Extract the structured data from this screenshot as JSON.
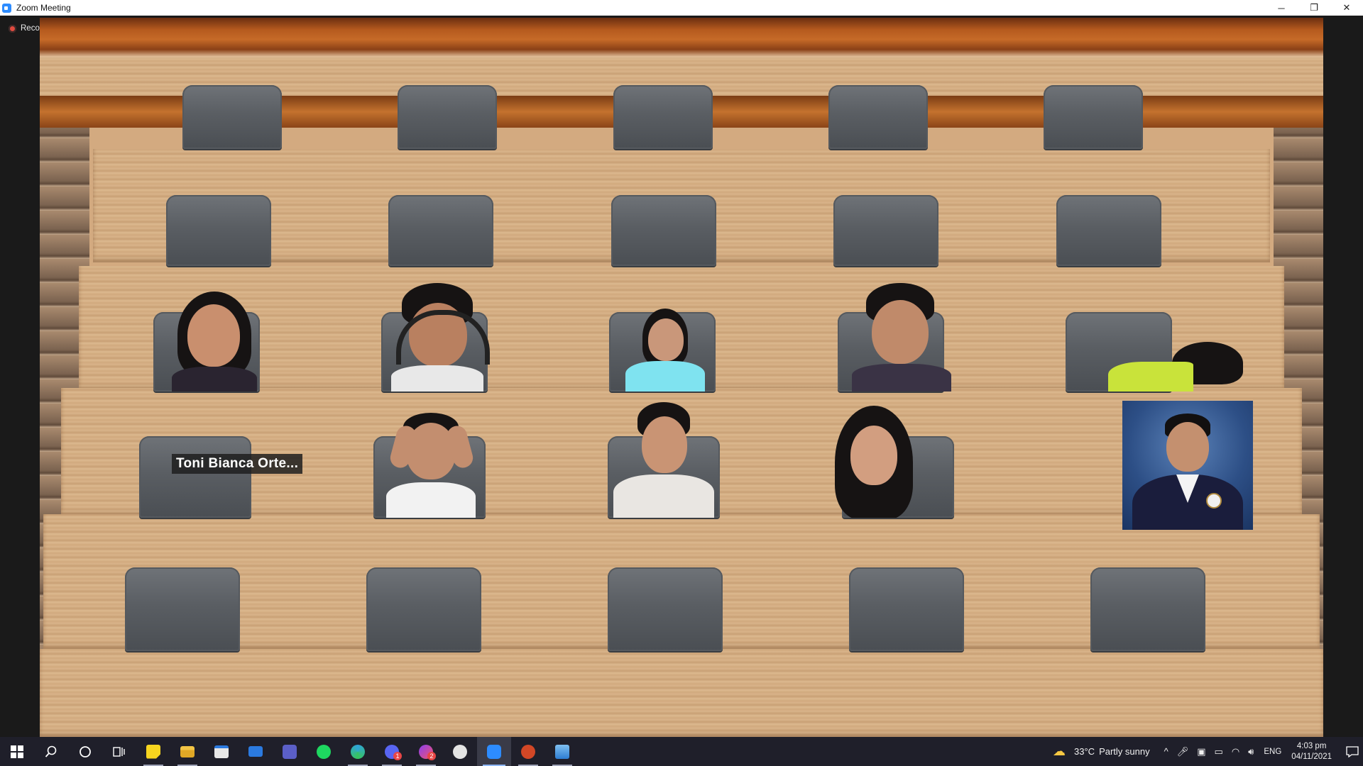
{
  "window": {
    "title": "Zoom Meeting",
    "minimize_glyph": "─",
    "restore_glyph": "❐",
    "close_glyph": "✕"
  },
  "meeting": {
    "recording_label": "Recording",
    "name_label": "Toni Bianca Orte..."
  },
  "taskbar": {
    "apps": [
      {
        "name": "start-icon",
        "color": "#ffffff"
      },
      {
        "name": "search-icon",
        "color": "#ffffff"
      },
      {
        "name": "cortana-icon",
        "color": "#ffffff"
      },
      {
        "name": "task-view-icon",
        "color": "#ffffff"
      },
      {
        "name": "sticky-notes-icon",
        "color": "#f7d51f"
      },
      {
        "name": "file-explorer-icon",
        "color": "#f3c545"
      },
      {
        "name": "store-icon",
        "color": "#ffffff"
      },
      {
        "name": "mail-icon",
        "color": "#2b7ae0"
      },
      {
        "name": "teams-icon",
        "color": "#5b5fc7"
      },
      {
        "name": "spotify-icon",
        "color": "#1ed760"
      },
      {
        "name": "edge-icon",
        "color": "#2fa4d9"
      },
      {
        "name": "discord-icon",
        "color": "#5865f2"
      },
      {
        "name": "messenger-icon",
        "color": "#d43f8d"
      },
      {
        "name": "app-icon",
        "color": "#e4e4e4"
      },
      {
        "name": "zoom-icon",
        "color": "#2d8cff"
      },
      {
        "name": "powerpoint-icon",
        "color": "#d24726"
      },
      {
        "name": "photos-icon",
        "color": "#2d7dd2"
      }
    ],
    "messenger_badge": "2",
    "discord_badge": "1",
    "weather_temp": "33°C",
    "weather_text": "Partly sunny",
    "language": "ENG",
    "time": "4:03 pm",
    "date": "04/11/2021"
  }
}
